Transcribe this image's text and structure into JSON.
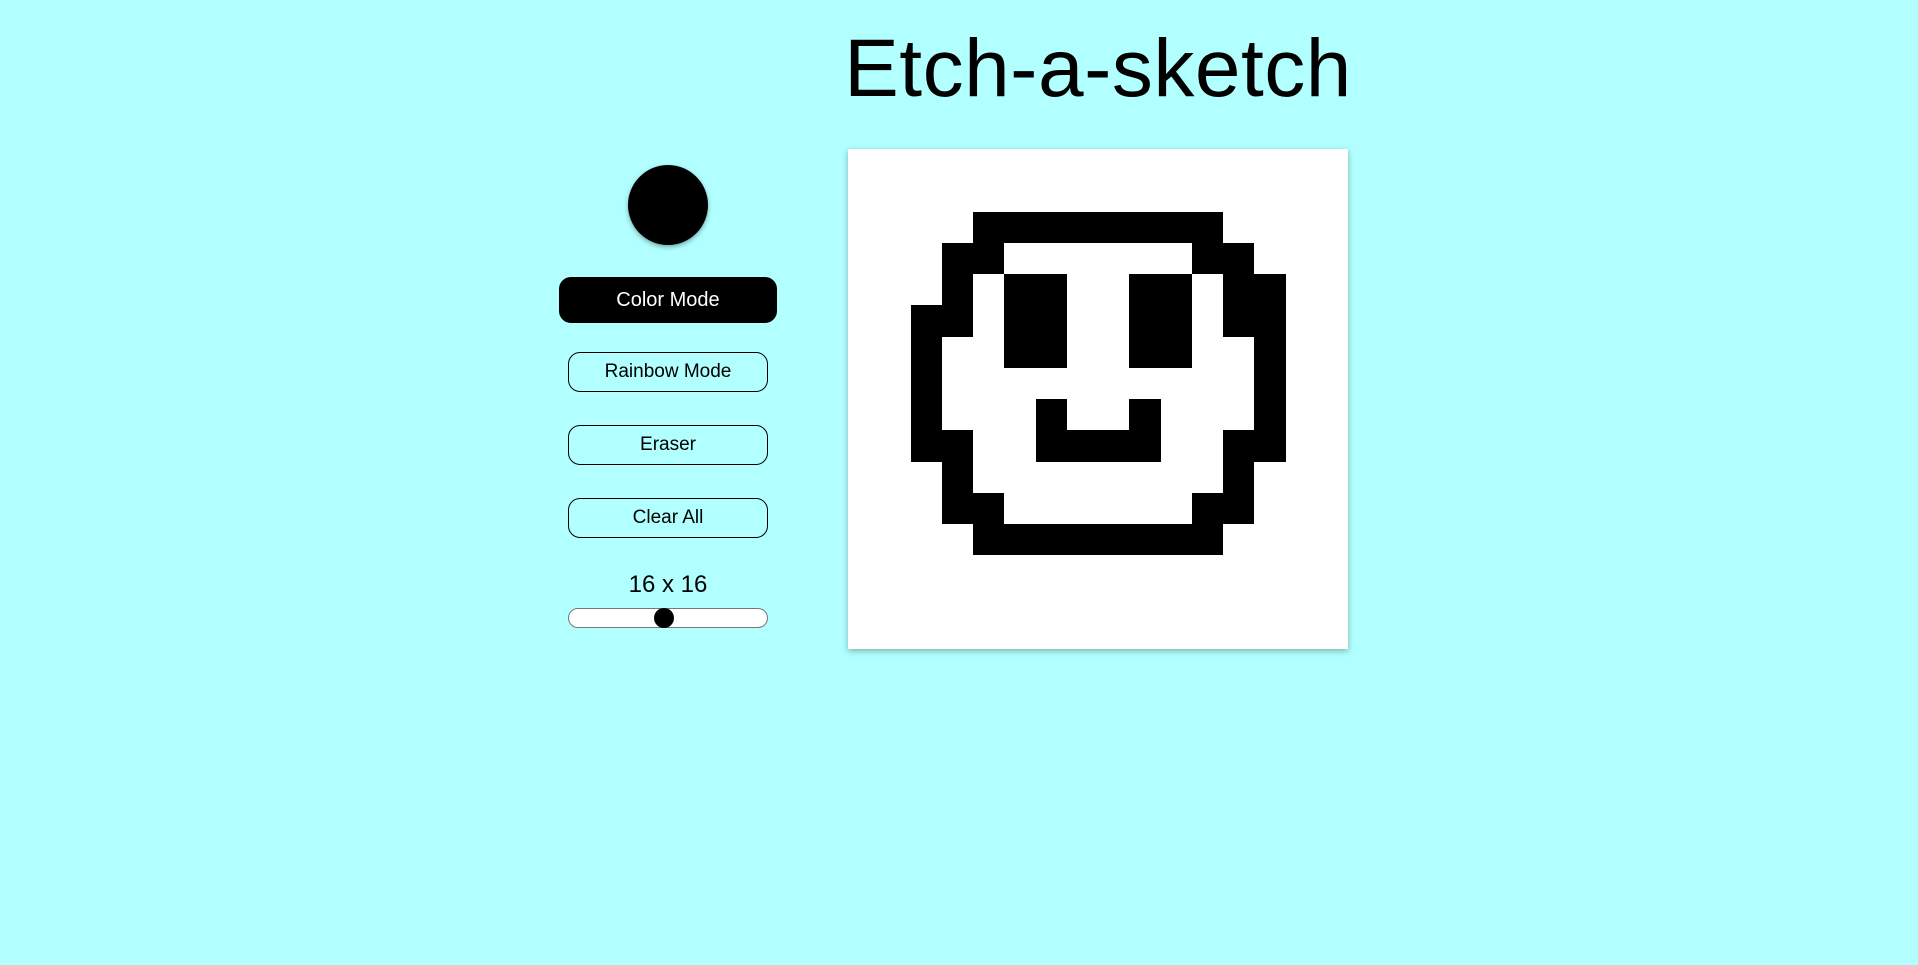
{
  "app": {
    "title": "Etch-a-sketch"
  },
  "controls": {
    "current_color": "#000000",
    "color_mode_label": "Color Mode",
    "rainbow_mode_label": "Rainbow Mode",
    "eraser_label": "Eraser",
    "clear_all_label": "Clear All",
    "active_mode": "color",
    "grid_size_label": "16 x 16",
    "grid_size": 16,
    "slider_min": 1,
    "slider_max": 64
  },
  "colors": {
    "background": "#b1ffff",
    "ink": "#000000",
    "board": "#ffffff"
  },
  "board": {
    "filled_cells": [
      [
        2,
        4
      ],
      [
        2,
        5
      ],
      [
        2,
        6
      ],
      [
        2,
        7
      ],
      [
        2,
        8
      ],
      [
        2,
        9
      ],
      [
        2,
        10
      ],
      [
        2,
        11
      ],
      [
        3,
        3
      ],
      [
        3,
        4
      ],
      [
        3,
        11
      ],
      [
        3,
        12
      ],
      [
        4,
        3
      ],
      [
        4,
        13
      ],
      [
        4,
        12
      ],
      [
        4,
        5
      ],
      [
        4,
        6
      ],
      [
        4,
        9
      ],
      [
        4,
        10
      ],
      [
        5,
        2
      ],
      [
        5,
        3
      ],
      [
        5,
        12
      ],
      [
        5,
        13
      ],
      [
        5,
        5
      ],
      [
        5,
        6
      ],
      [
        5,
        9
      ],
      [
        5,
        10
      ],
      [
        6,
        2
      ],
      [
        6,
        13
      ],
      [
        6,
        5
      ],
      [
        6,
        6
      ],
      [
        6,
        9
      ],
      [
        6,
        10
      ],
      [
        7,
        2
      ],
      [
        7,
        13
      ],
      [
        8,
        2
      ],
      [
        8,
        13
      ],
      [
        8,
        6
      ],
      [
        8,
        9
      ],
      [
        9,
        2
      ],
      [
        9,
        3
      ],
      [
        9,
        12
      ],
      [
        9,
        13
      ],
      [
        9,
        6
      ],
      [
        9,
        7
      ],
      [
        9,
        8
      ],
      [
        9,
        9
      ],
      [
        10,
        3
      ],
      [
        10,
        12
      ],
      [
        11,
        3
      ],
      [
        11,
        4
      ],
      [
        11,
        11
      ],
      [
        11,
        12
      ],
      [
        12,
        4
      ],
      [
        12,
        5
      ],
      [
        12,
        6
      ],
      [
        12,
        7
      ],
      [
        12,
        8
      ],
      [
        12,
        9
      ],
      [
        12,
        10
      ],
      [
        12,
        11
      ]
    ]
  }
}
